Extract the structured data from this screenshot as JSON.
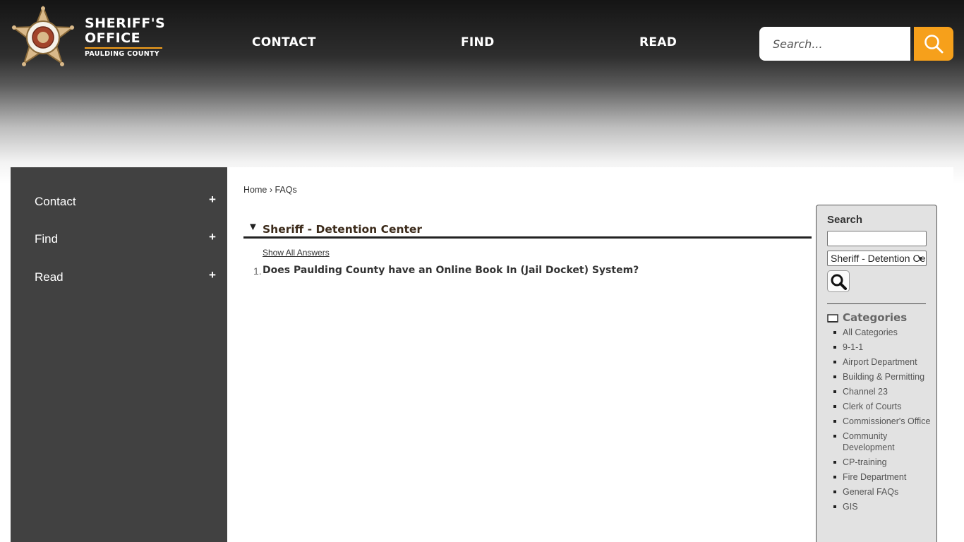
{
  "header": {
    "logo": {
      "line1": "SHERIFF'S",
      "line2": "OFFICE",
      "sub": "PAULDING COUNTY",
      "badge_text": "GARY GULLEDGE SHERIFF"
    },
    "nav": [
      "CONTACT",
      "FIND",
      "READ"
    ],
    "search_placeholder": "Search...",
    "search_icon": "search-icon",
    "accent_color": "#f6a01b"
  },
  "sidebar": {
    "items": [
      {
        "label": "Contact",
        "expand": "+"
      },
      {
        "label": "Find",
        "expand": "+"
      },
      {
        "label": "Read",
        "expand": "+"
      }
    ]
  },
  "breadcrumb": {
    "home": "Home",
    "sep": "›",
    "current": "FAQs"
  },
  "faq": {
    "arrow": "▼",
    "section_title": "Sheriff - Detention Center",
    "show_all": "Show All Answers",
    "questions": [
      {
        "num": "1.",
        "text": "Does Paulding County have an Online Book In (Jail Docket) System?"
      }
    ]
  },
  "right_panel": {
    "search_label": "Search",
    "select_value": "Sheriff - Detention Center",
    "categories_title": "Categories",
    "categories": [
      "All Categories",
      "9-1-1",
      "Airport Department",
      "Building & Permitting",
      "Channel 23",
      "Clerk of Courts",
      "Commissioner's Office",
      "Community Development",
      "CP-training",
      "Fire Department",
      "General FAQs",
      "GIS"
    ]
  }
}
